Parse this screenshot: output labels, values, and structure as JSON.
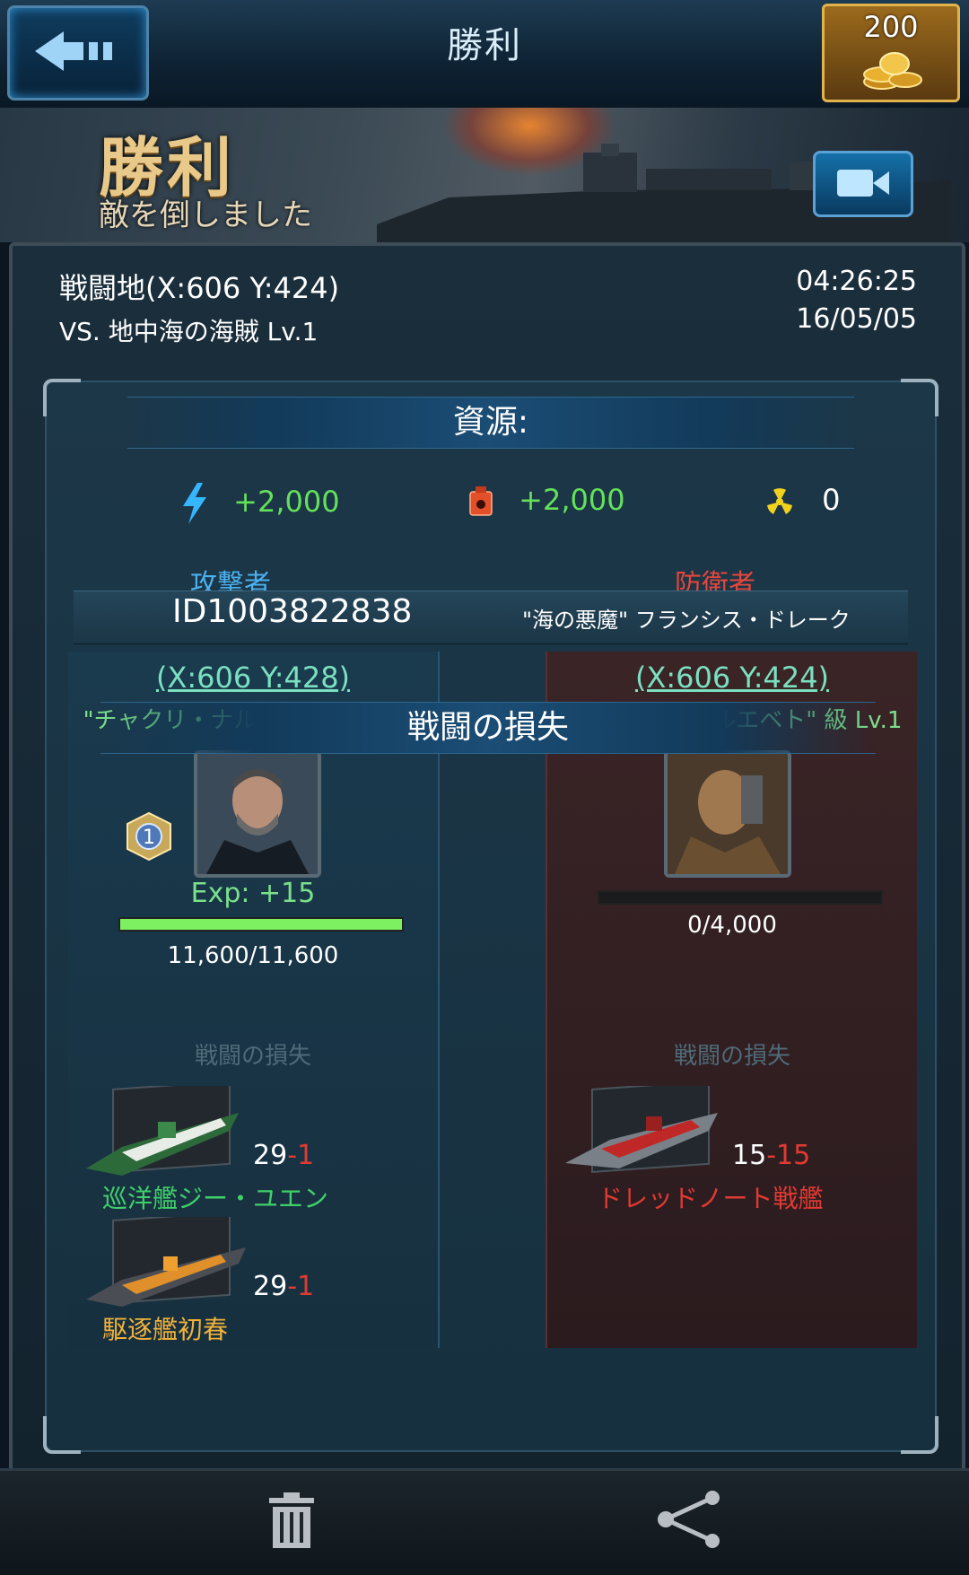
{
  "header": {
    "title": "勝利",
    "gold": "200",
    "back_icon": "back-arrow-icon",
    "coins_icon": "gold-coins-icon"
  },
  "banner": {
    "headline": "勝利",
    "subline": "敵を倒しました",
    "replay_icon": "video-replay-icon"
  },
  "report": {
    "location": "戦闘地(X:606 Y:424)",
    "opponent": "VS. 地中海の海賊 Lv.1",
    "time": "04:26:25",
    "date": "16/05/05"
  },
  "resources": {
    "title": "資源:",
    "items": [
      {
        "icon": "energy-bolt-icon",
        "value": "+2,000"
      },
      {
        "icon": "oil-canister-icon",
        "value": "+2,000"
      },
      {
        "icon": "uranium-radiation-icon",
        "value": "0"
      }
    ]
  },
  "attacker": {
    "role": "攻撃者",
    "id": "ID1003822838",
    "coords": "(X:606 Y:428)",
    "ship_class": "\"チャクリ・ナルエベト\" 級 Lv.1",
    "rank": "1",
    "exp": "Exp: +15",
    "hp_fraction": 1.0,
    "hp": "11,600/11,600"
  },
  "defender": {
    "role": "防衛者",
    "name": "\"海の悪魔\" フランシス・ドレーク",
    "coords": "(X:606 Y:424)",
    "ship_class": "\"チャクリ・ナルエベト\" 級 Lv.1",
    "hp_fraction": 0.0,
    "hp": "0/4,000"
  },
  "losses": {
    "title": "戦闘の損失",
    "attacker_label": "戦闘の損失",
    "defender_label": "戦闘の損失",
    "attacker_units": [
      {
        "name": "巡洋艦ジー・ユエン",
        "count": "29",
        "loss": "-1",
        "color": "#3fd06a"
      },
      {
        "name": "駆逐艦初春",
        "count": "29",
        "loss": "-1",
        "color": "#f2b23a"
      }
    ],
    "defender_units": [
      {
        "name": "ドレッドノート戦艦",
        "count": "15",
        "loss": "-15",
        "color": "#e03a32"
      }
    ]
  },
  "footer": {
    "delete_icon": "trash-icon",
    "share_icon": "share-icon"
  }
}
